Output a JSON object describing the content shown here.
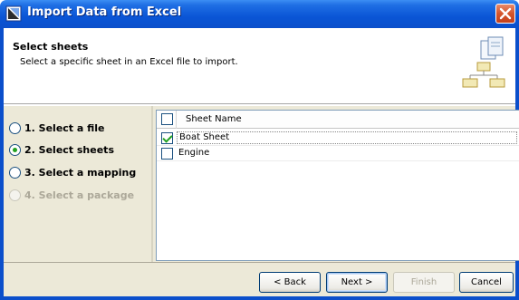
{
  "window": {
    "title": "Import Data from Excel",
    "app_icon": "import-icon",
    "close_icon": "close-icon",
    "close_glyph": "✕"
  },
  "header": {
    "title": "Select sheets",
    "description": "Select a specific sheet in an Excel file to import.",
    "icon": "sheet-hierarchy-icon"
  },
  "steps": [
    {
      "label": "1. Select a file",
      "selected": false,
      "enabled": true
    },
    {
      "label": "2. Select sheets",
      "selected": true,
      "enabled": true
    },
    {
      "label": "3. Select a mapping",
      "selected": false,
      "enabled": true
    },
    {
      "label": "4. Select a package",
      "selected": false,
      "enabled": false
    }
  ],
  "table": {
    "header_label": "Sheet Name",
    "header_checked": false,
    "rows": [
      {
        "name": "Boat Sheet",
        "checked": true
      },
      {
        "name": "Engine",
        "checked": false
      }
    ]
  },
  "buttons": {
    "back": "< Back",
    "next": "Next >",
    "finish": "Finish",
    "cancel": "Cancel"
  },
  "colors": {
    "titlebar": "#0a55d6",
    "dialog_bg": "#ece9d8",
    "check_green": "#21a121"
  }
}
